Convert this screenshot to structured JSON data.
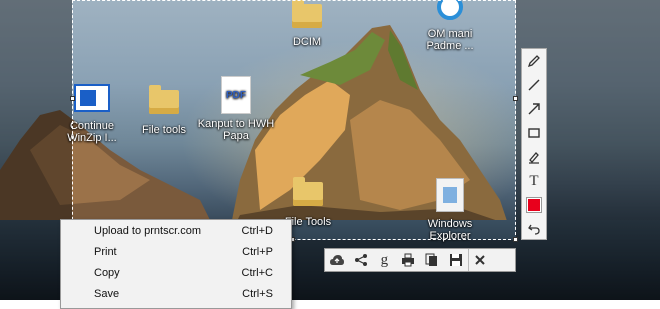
{
  "desktop_icons": [
    {
      "id": "dcim",
      "label": "DCIM",
      "kind": "folder"
    },
    {
      "id": "om",
      "label": "OM mani Padme ...",
      "kind": "app"
    },
    {
      "id": "winzip",
      "label": "Continue WinZip I...",
      "kind": "winzip"
    },
    {
      "id": "filetools",
      "label": "File tools",
      "kind": "folder"
    },
    {
      "id": "pdf",
      "label": "Kanput to HWH Papa",
      "kind": "pdf"
    },
    {
      "id": "filetools2",
      "label": "File Tools",
      "kind": "folder"
    },
    {
      "id": "explorer",
      "label": "Windows Explorer",
      "kind": "explorer"
    }
  ],
  "pdf_badge": "PDF",
  "palette": {
    "tools": [
      "marker",
      "line",
      "arrow",
      "rectangle",
      "highlighter",
      "text",
      "color",
      "undo"
    ],
    "text_tool_label": "T",
    "color": "#e8001c"
  },
  "actionbar": {
    "buttons": [
      "upload",
      "share",
      "google",
      "print",
      "copy",
      "save",
      "close"
    ]
  },
  "context_menu": {
    "items": [
      {
        "label": "Upload to prntscr.com",
        "shortcut": "Ctrl+D"
      },
      {
        "label": "Print",
        "shortcut": "Ctrl+P"
      },
      {
        "label": "Copy",
        "shortcut": "Ctrl+C"
      },
      {
        "label": "Save",
        "shortcut": "Ctrl+S"
      }
    ]
  }
}
